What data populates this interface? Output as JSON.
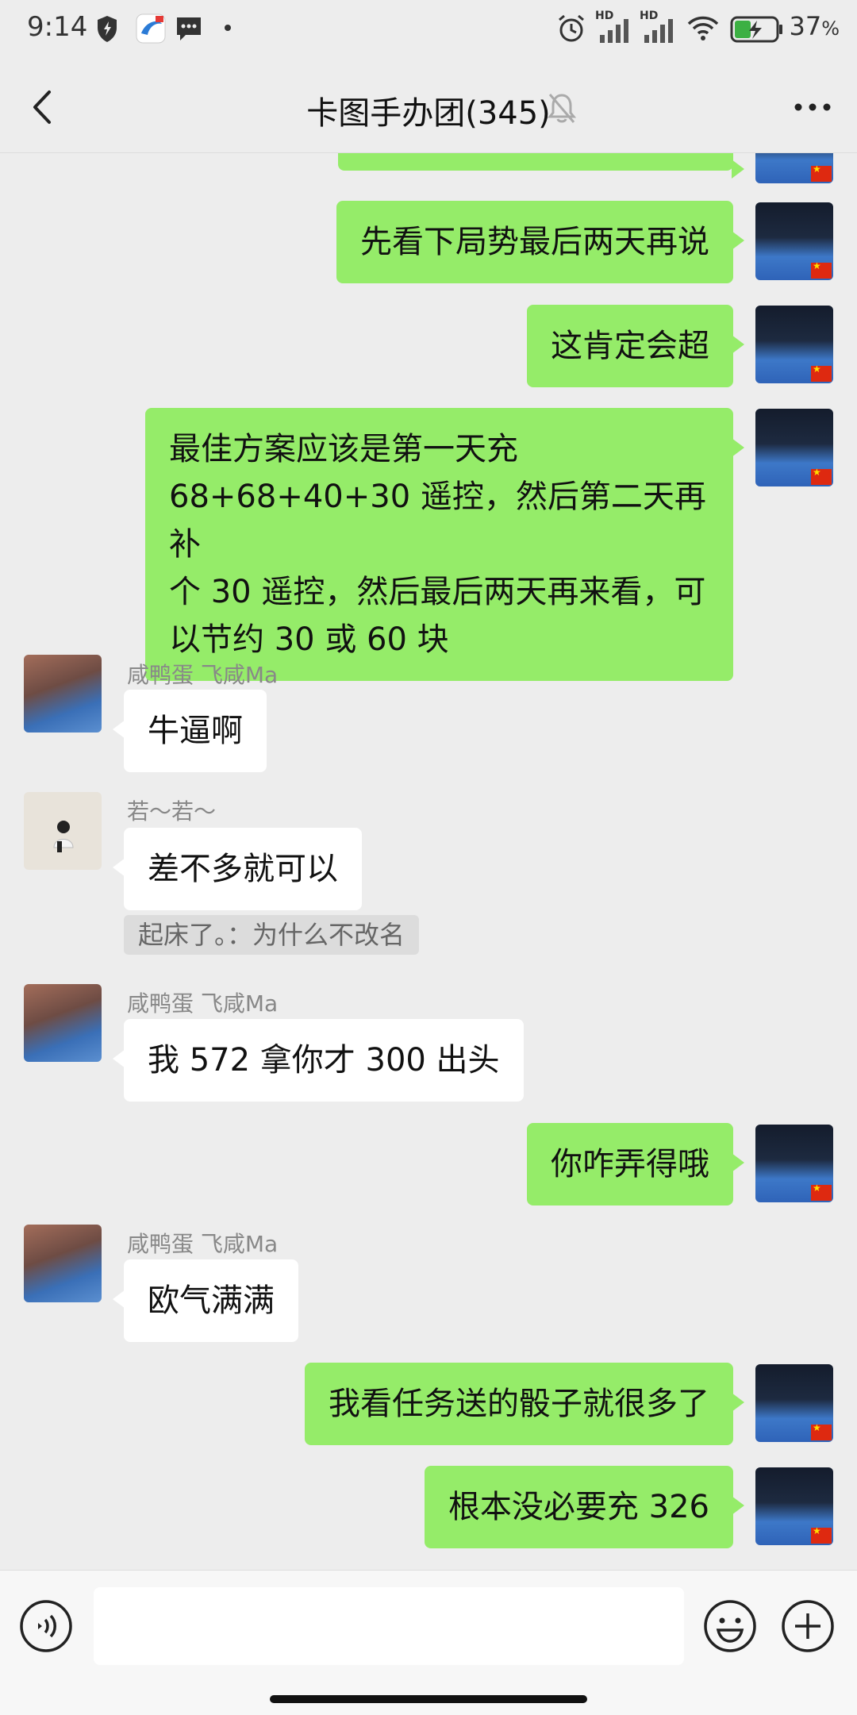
{
  "status_bar": {
    "time": "9:14",
    "battery_percent": "37",
    "battery_unit": "%",
    "signal_label_1": "HD",
    "signal_label_2": "HD",
    "icons": [
      "shield-icon",
      "browser-app-icon",
      "message-icon",
      "dot-icon",
      "alarm-icon",
      "signal-icon",
      "signal-icon",
      "wifi-icon",
      "battery-charging-icon"
    ]
  },
  "nav": {
    "title": "卡图手办团(345)",
    "back_icon": "back-chevron-icon",
    "mute_icon": "bell-off-icon",
    "more_icon": "more-dots-icon"
  },
  "colors": {
    "outgoing_bubble": "#95ec69",
    "incoming_bubble": "#ffffff",
    "background": "#ededed"
  },
  "messages": [
    {
      "direction": "out",
      "text": "先看下局势最后两天再说"
    },
    {
      "direction": "out",
      "text": "这肯定会超"
    },
    {
      "direction": "out",
      "lines": [
        "最佳方案应该是第一天充",
        "68+68+40+30 遥控，然后第二天再补",
        "个 30 遥控，然后最后两天再来看，可",
        "以节约 30 或 60 块"
      ]
    },
    {
      "direction": "in",
      "sender": "咸鸭蛋 飞咸Ma",
      "text": "牛逼啊"
    },
    {
      "direction": "in",
      "sender": "若～若～",
      "text": "差不多就可以",
      "quote": "起床了。：为什么不改名"
    },
    {
      "direction": "in",
      "sender": "咸鸭蛋 飞咸Ma",
      "text": "我 572 拿你才 300 出头"
    },
    {
      "direction": "out",
      "text": "你咋弄得哦"
    },
    {
      "direction": "in",
      "sender": "咸鸭蛋 飞咸Ma",
      "text": "欧气满满"
    },
    {
      "direction": "out",
      "text": "我看任务送的骰子就很多了"
    },
    {
      "direction": "out",
      "text": "根本没必要充 326"
    }
  ],
  "input": {
    "value": "",
    "placeholder": "",
    "voice_icon": "voice-icon",
    "emoji_icon": "emoji-icon",
    "plus_icon": "plus-icon"
  }
}
